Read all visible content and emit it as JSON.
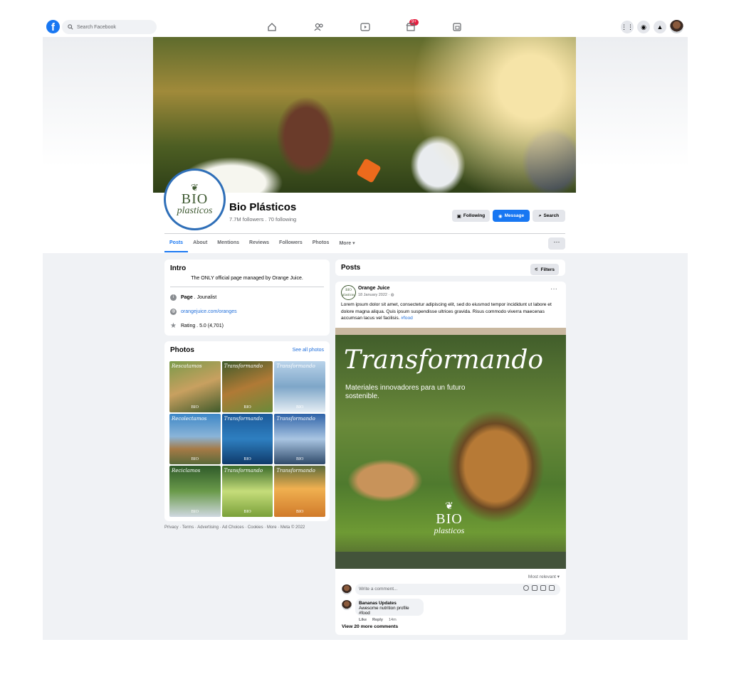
{
  "nav": {
    "search_placeholder": "Search Facebook",
    "video_badge": "9+",
    "center_icons": [
      "home-icon",
      "friends-icon",
      "watch-icon",
      "marketplace-icon",
      "groups-icon"
    ],
    "right_icons": [
      "menu-grid-icon",
      "messenger-icon",
      "bell-icon"
    ]
  },
  "page": {
    "name": "Bio Plásticos",
    "followers": "7.7M followers . 70 following",
    "buttons": {
      "following": "Following",
      "message": "Message",
      "search": "Search"
    },
    "logo_top": "BIO",
    "logo_bottom": "plasticos"
  },
  "tabs": [
    "Posts",
    "About",
    "Mentions",
    "Reviews",
    "Followers",
    "Photos",
    "More ▾"
  ],
  "more_button": "···",
  "intro": {
    "title": "Intro",
    "bio": "The ONLY official page managed by Orange Juice.",
    "page_label": "Page",
    "page_category": " . Jounalist",
    "website": "orangejuice.com/oranges",
    "rating": "Rating . 5.0 (4,701)"
  },
  "photos": {
    "title": "Photos",
    "see_all": "See all photos",
    "items": [
      {
        "caption": "Rescatamos",
        "bg": "linear-gradient(160deg,#7a9a4a,#c8a060 50%,#3f5a2a)"
      },
      {
        "caption": "Transformando",
        "bg": "linear-gradient(160deg,#3e5a2a,#b07a36 50%,#6a8a3a)"
      },
      {
        "caption": "Transformando",
        "bg": "linear-gradient(180deg,#b9d3ea,#7ea6c8 50%,#e6eef4)"
      },
      {
        "caption": "Recolectamos",
        "bg": "linear-gradient(180deg,#3d87c6,#8ab4d8 45%,#a57a46 70%,#5a6a3a)"
      },
      {
        "caption": "Transformando",
        "bg": "linear-gradient(180deg,#1c5a9a,#2e7fc0 50%,#0f3a6a)"
      },
      {
        "caption": "Transformando",
        "bg": "linear-gradient(180deg,#2f63a8,#a9c5e2 50%,#2f4a6a)"
      },
      {
        "caption": "Reciclamos",
        "bg": "linear-gradient(180deg,#2f5a2a,#6a9a4a 50%,#cfd8e0)"
      },
      {
        "caption": "Transformando",
        "bg": "linear-gradient(180deg,#3a6a2a,#c5dd7a 50%,#7aa03a)"
      },
      {
        "caption": "Transformando",
        "bg": "linear-gradient(180deg,#5a6a3a,#f0b050 45%,#d07a2a)"
      }
    ],
    "logo_text": "BIO"
  },
  "footer": "Privacy · Terms · Advertising · Ad Choices · Cookies · More · Meta © 2022",
  "posts": {
    "title": "Posts",
    "filters": "Filters",
    "post": {
      "avatar_text": "BIO plasticos",
      "author": "Orange Juice",
      "date": "18 January 2022 ·",
      "body": "Lorem ipsum dolor sit amet, consectetur adipiscing elit, sed do eiusmod tempor incididunt ut labore et dolore magna aliqua. Quis ipsum suspendisse ultrices gravida. Risus commodo viverra maecenas accumsan lacus vel facilisis.",
      "hashtag": "#food",
      "image_title": "Transformando",
      "image_subtitle": "Materiales innovadores para un futuro sostenible.",
      "image_logo_top": "BIO",
      "image_logo_bottom": "plasticos"
    },
    "sort": "Most relevant ▾",
    "comment_placeholder": "Write a comment...",
    "comment": {
      "author": "Bananas Updates",
      "text": "Awesome nutrition profile #food",
      "like": "Like",
      "reply": "Reply",
      "time": "14m"
    },
    "view_more": "View 20 more comments"
  }
}
